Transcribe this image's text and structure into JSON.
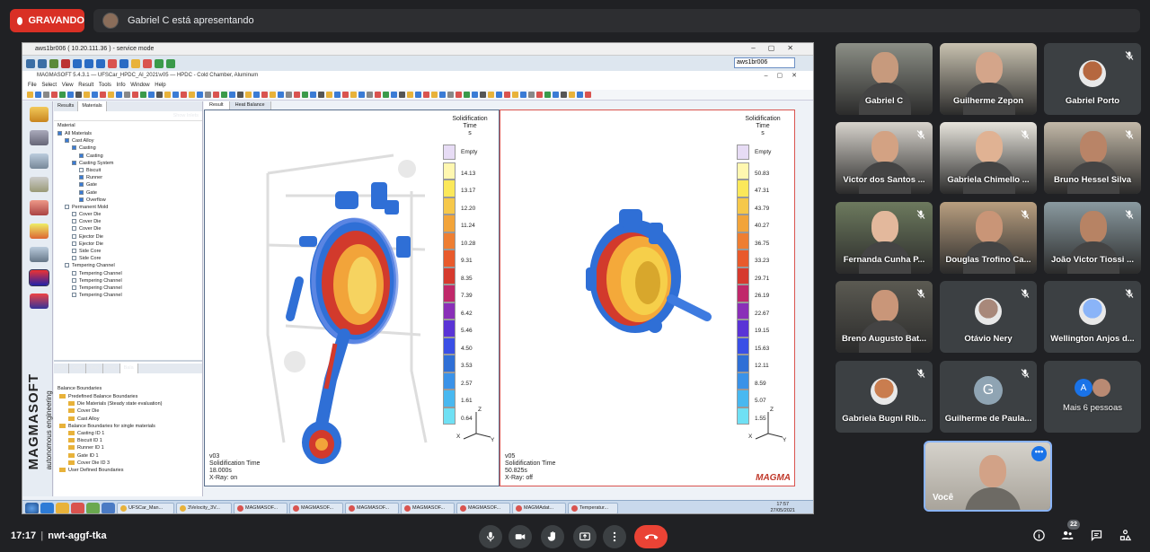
{
  "recording": {
    "label": "GRAVANDO"
  },
  "presenter": {
    "banner": "Gabriel C está apresentando"
  },
  "remote_desktop": {
    "title": "aws1br006 ( 10.20.111.36 ) - service mode",
    "host": "aws1br006"
  },
  "app": {
    "title": "MAGMASOFT 5.4.3.1 — UFSCar_HPDC_Al_2021\\v05 — HPDC - Cold Chamber, Aluminum",
    "menu": [
      "File",
      "Select",
      "View",
      "Result",
      "Tools",
      "Info",
      "Window",
      "Help"
    ],
    "left_tabs": [
      "Results",
      "Materials"
    ],
    "show_inlets": "Show Inlets",
    "tree_header": "Material",
    "tree": [
      {
        "label": "All Materials",
        "level": 0,
        "checked": true
      },
      {
        "label": "Cast Alloy",
        "level": 1,
        "checked": true
      },
      {
        "label": "Casting",
        "level": 2,
        "checked": true
      },
      {
        "label": "Casting",
        "level": 3,
        "checked": true
      },
      {
        "label": "Casting System",
        "level": 2,
        "checked": true
      },
      {
        "label": "Biscuit",
        "level": 3,
        "checked": false
      },
      {
        "label": "Runner",
        "level": 3,
        "checked": true
      },
      {
        "label": "Gate",
        "level": 3,
        "checked": true
      },
      {
        "label": "Gate",
        "level": 3,
        "checked": true
      },
      {
        "label": "Overflow",
        "level": 3,
        "checked": true
      },
      {
        "label": "Permanent Mold",
        "level": 1,
        "checked": false
      },
      {
        "label": "Cover Die",
        "level": 2,
        "checked": false
      },
      {
        "label": "Cover Die",
        "level": 2,
        "checked": false
      },
      {
        "label": "Cover Die",
        "level": 2,
        "checked": false
      },
      {
        "label": "Ejector Die",
        "level": 2,
        "checked": false
      },
      {
        "label": "Ejector Die",
        "level": 2,
        "checked": false
      },
      {
        "label": "Side Core",
        "level": 2,
        "checked": false
      },
      {
        "label": "Side Core",
        "level": 2,
        "checked": false
      },
      {
        "label": "Tempering Channel",
        "level": 1,
        "checked": false
      },
      {
        "label": "Tempering Channel",
        "level": 2,
        "checked": false
      },
      {
        "label": "Tempering Channel",
        "level": 2,
        "checked": false
      },
      {
        "label": "Tempering Channel",
        "level": 2,
        "checked": false
      },
      {
        "label": "Tempering Channel",
        "level": 2,
        "checked": false
      }
    ],
    "lower_tabs": [
      "Ani",
      "Gen",
      "Res",
      "Pos",
      "Bala"
    ],
    "balance_header": "Balance Boundaries",
    "balance": [
      {
        "label": "Predefined Balance Boundaries",
        "level": 0
      },
      {
        "label": "Die Materials (Steady state evaluation)",
        "level": 1
      },
      {
        "label": "Cover Die",
        "level": 1
      },
      {
        "label": "Cast Alloy",
        "level": 1
      },
      {
        "label": "Balance Boundaries for single materials",
        "level": 0
      },
      {
        "label": "Casting ID 1",
        "level": 1
      },
      {
        "label": "Biscuit ID 1",
        "level": 1
      },
      {
        "label": "Runner ID 1",
        "level": 1
      },
      {
        "label": "Gate ID 1",
        "level": 1
      },
      {
        "label": "Cover Die ID 3",
        "level": 1
      },
      {
        "label": "User Defined Boundaries",
        "level": 0
      }
    ],
    "view_tabs": [
      "Result",
      "Heat Balance"
    ],
    "brand": "MAGMASOFT",
    "brand_sub": "autonomous engineering",
    "logo": "MAGMA"
  },
  "viewport_left": {
    "legend_title": [
      "Solidification",
      "Time",
      "s"
    ],
    "legend_labels": [
      "Empty",
      "14.13",
      "13.17",
      "12.20",
      "11.24",
      "10.28",
      "9.31",
      "8.35",
      "7.39",
      "6.42",
      "5.46",
      "4.50",
      "3.53",
      "2.57",
      "1.61",
      "0.64"
    ],
    "info": [
      "v03",
      "Solidification Time",
      "18.000s",
      "X-Ray: on"
    ]
  },
  "viewport_right": {
    "legend_title": [
      "Solidification",
      "Time",
      "s"
    ],
    "legend_labels": [
      "Empty",
      "50.83",
      "47.31",
      "43.79",
      "40.27",
      "36.75",
      "33.23",
      "29.71",
      "26.19",
      "22.67",
      "19.15",
      "15.63",
      "12.11",
      "8.59",
      "5.07",
      "1.55"
    ],
    "info": [
      "v05",
      "Solidification Time",
      "50.825s",
      "X-Ray: off"
    ]
  },
  "axis_labels": {
    "z": "Z",
    "x": "X",
    "y": "Y"
  },
  "taskbar": {
    "items": [
      "UFSCar_Man...",
      "3Velocity_3V...",
      "MAGMASOF...",
      "MAGMASOF...",
      "MAGMASOF...",
      "MAGMASOF...",
      "MAGMASOF...",
      "MAGMAdat...",
      "Temperatur..."
    ],
    "clock_time": "17:57",
    "clock_date": "27/05/2021"
  },
  "participants": [
    {
      "name": "Gabriel C",
      "muted": false,
      "video": true,
      "bg": "#8c8f86",
      "skin": "#c79a7d"
    },
    {
      "name": "Guilherme Zepon",
      "muted": false,
      "video": true,
      "bg": "#c9c2b0",
      "skin": "#d4a58a"
    },
    {
      "name": "Gabriel Porto",
      "muted": true,
      "video": false
    },
    {
      "name": "Victor dos Santos ...",
      "muted": true,
      "video": true,
      "bg": "#d7d3cc",
      "skin": "#d3a283"
    },
    {
      "name": "Gabriela Chimello ...",
      "muted": true,
      "video": true,
      "bg": "#e7e4dc",
      "skin": "#e0b293"
    },
    {
      "name": "Bruno Hessel Silva",
      "muted": true,
      "video": true,
      "bg": "#c3b9a8",
      "skin": "#b98467"
    },
    {
      "name": "Fernanda Cunha P...",
      "muted": true,
      "video": true,
      "bg": "#6d7a5e",
      "skin": "#e3b89c"
    },
    {
      "name": "Douglas Trofino Ca...",
      "muted": true,
      "video": true,
      "bg": "#b99f80",
      "skin": "#c99577"
    },
    {
      "name": "João Victor Tiossi ...",
      "muted": true,
      "video": true,
      "bg": "#8a9aa0",
      "skin": "#b78364"
    },
    {
      "name": "Breno Augusto Bat...",
      "muted": true,
      "video": true,
      "bg": "#5b5a52",
      "skin": "#c99679"
    },
    {
      "name": "Otávio Nery",
      "muted": true,
      "video": false
    },
    {
      "name": "Wellington Anjos d...",
      "muted": true,
      "video": false
    },
    {
      "name": "Gabriela Bugni Rib...",
      "muted": true,
      "video": false
    },
    {
      "name": "Guilherme de Paula...",
      "muted": true,
      "video": false,
      "letter": "G"
    },
    {
      "name": "Mais 6 pessoas",
      "muted": false,
      "video": false,
      "group": true,
      "letter": "A"
    }
  ],
  "self_tile": {
    "name": "Você"
  },
  "bottom": {
    "time": "17:17",
    "meeting_code": "nwt-aggf-tka",
    "people_count": "22"
  },
  "colors": {
    "accent": "#8ab4f8",
    "record": "#d93025",
    "end_call": "#ea4335",
    "tile": "#3c4043"
  }
}
